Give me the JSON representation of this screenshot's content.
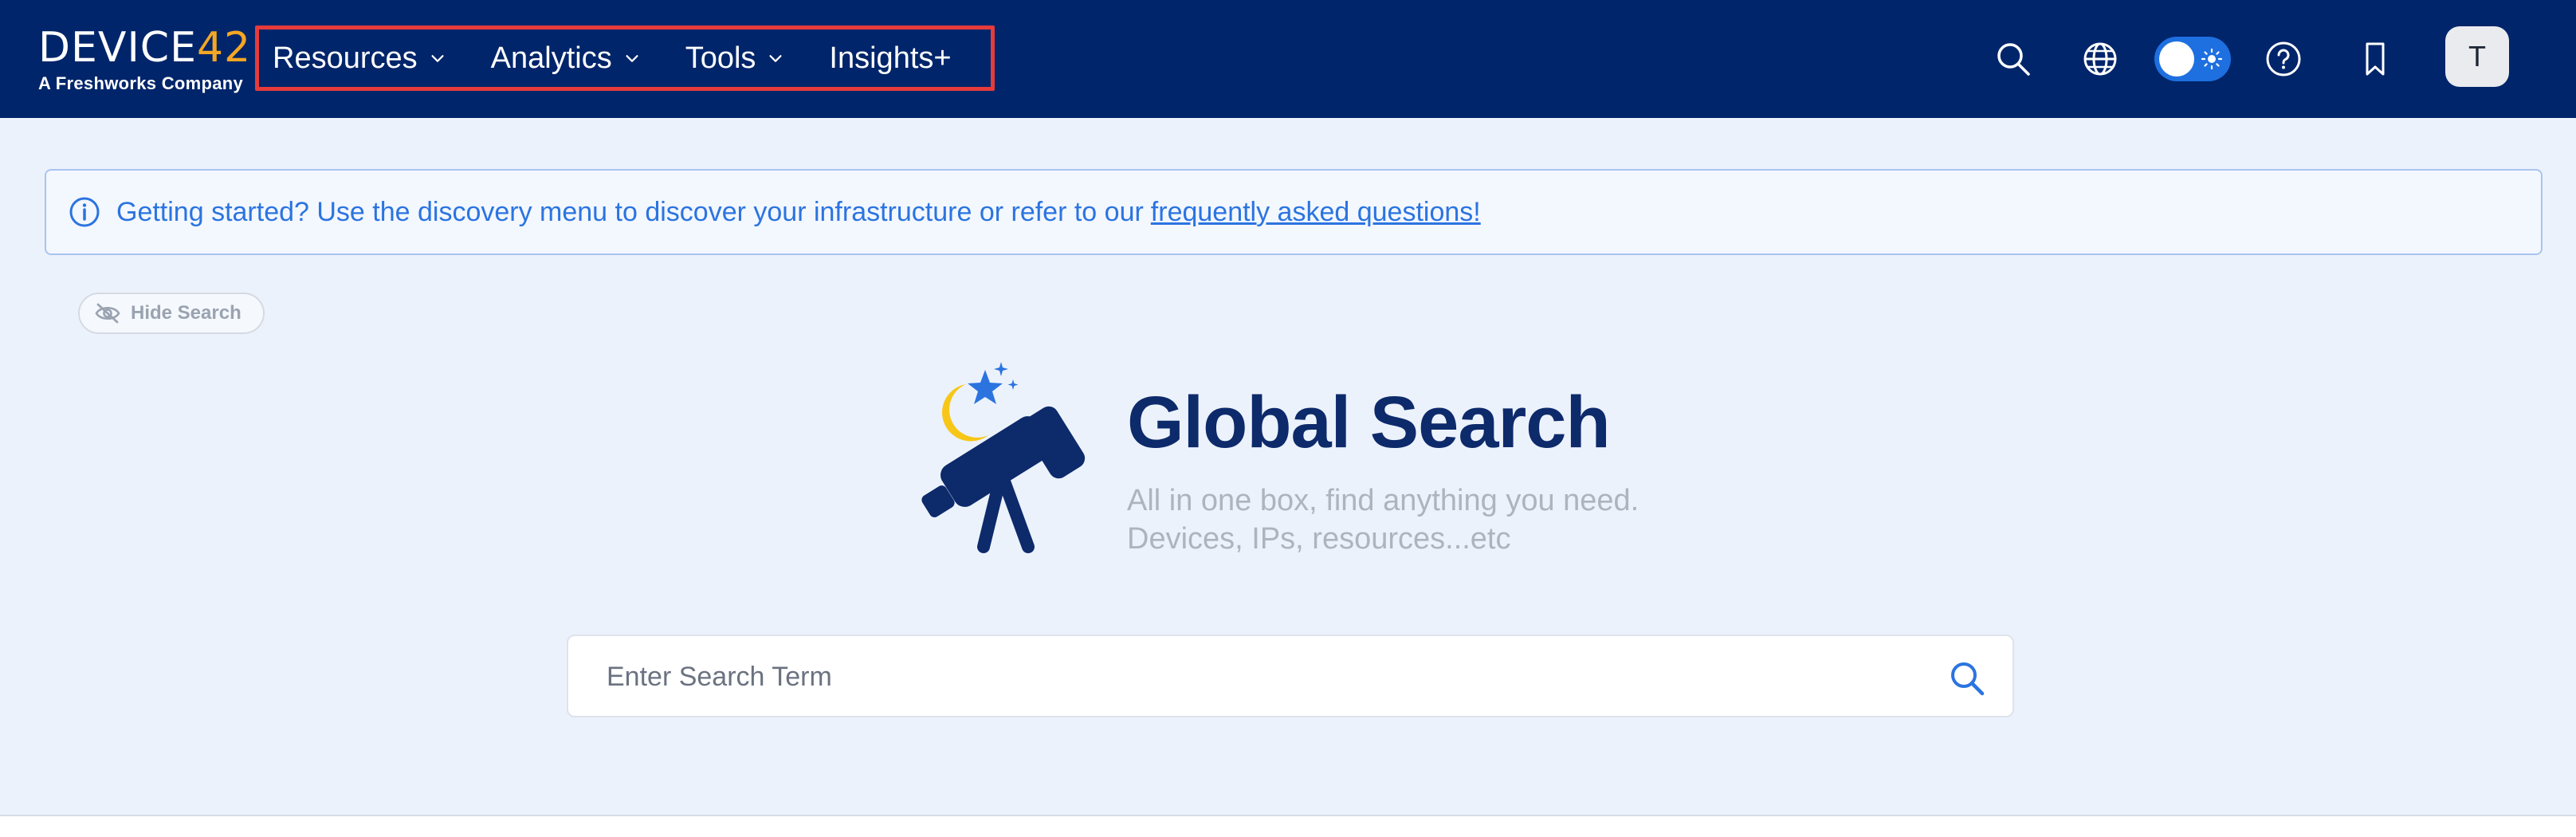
{
  "brand": {
    "logo_main": "DEVICE",
    "logo_accent": "42",
    "logo_sub": "A Freshworks Company"
  },
  "nav": {
    "items": [
      {
        "label": "Resources",
        "has_dropdown": true
      },
      {
        "label": "Analytics",
        "has_dropdown": true
      },
      {
        "label": "Tools",
        "has_dropdown": true
      },
      {
        "label": "Insights+",
        "has_dropdown": false
      }
    ],
    "highlight_color": "#e63b3b"
  },
  "topbar_icons": [
    "search-icon",
    "globe-icon",
    "theme-toggle",
    "help-icon",
    "bookmark-icon"
  ],
  "user": {
    "avatar_initial": "T"
  },
  "banner": {
    "icon": "info-icon",
    "text": "Getting started? Use the discovery menu to discover your infrastructure or refer to our",
    "link": "frequently asked questions!"
  },
  "hide_search": {
    "label": "Hide Search",
    "icon": "eye-slash-icon"
  },
  "hero": {
    "title": "Global Search",
    "subtitle_line1": "All in one box, find anything you need.",
    "subtitle_line2": "Devices, IPs, resources...etc"
  },
  "search": {
    "placeholder": "Enter Search Term",
    "value": "",
    "icon": "search-icon"
  },
  "colors": {
    "topbar": "#00256a",
    "accent": "#2b74e0",
    "page_bg": "#ecf2fb",
    "logo_accent": "#f5a623",
    "telescope": "#0d2a6b"
  }
}
